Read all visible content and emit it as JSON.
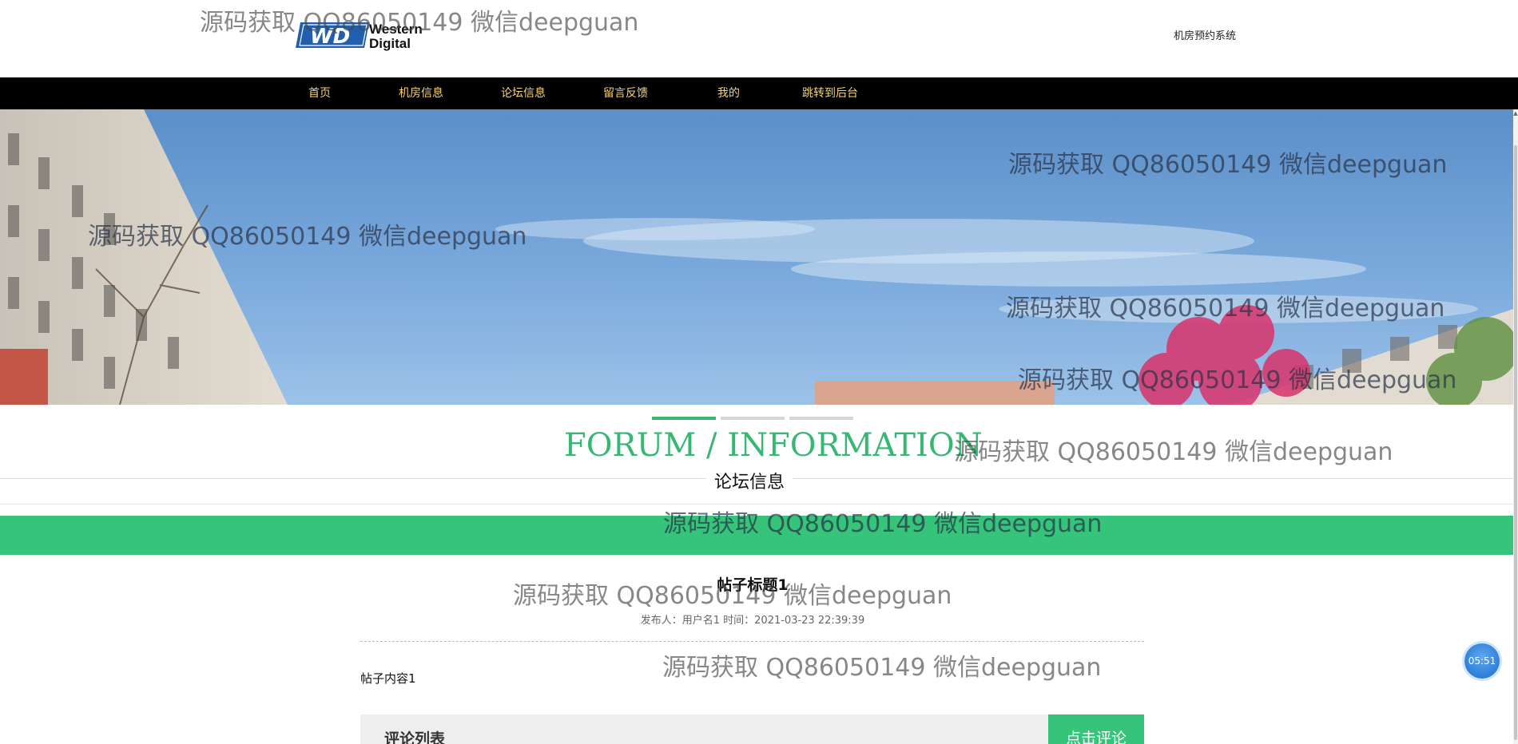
{
  "header": {
    "logo_line1": "Western",
    "logo_line2": "Digital",
    "logo_badge": "WD",
    "site_title": "机房预约系统"
  },
  "nav": {
    "items": [
      {
        "label": "首页"
      },
      {
        "label": "机房信息"
      },
      {
        "label": "论坛信息"
      },
      {
        "label": "留言反馈"
      },
      {
        "label": "我的"
      },
      {
        "label": "跳转到后台"
      }
    ]
  },
  "carousel": {
    "slide_count": 3,
    "active_index": 0
  },
  "section": {
    "title_en": "FORUM / INFORMATION",
    "title_cn": "论坛信息"
  },
  "post": {
    "title": "帖子标题1",
    "meta": "发布人：用户名1 时间：2021-03-23 22:39:39",
    "content": "帖子内容1"
  },
  "comments": {
    "title": "评论列表",
    "button_label": "点击评论"
  },
  "timer": {
    "label": "05:51"
  },
  "watermark": {
    "text": "源码获取 QQ86050149 微信deepguan"
  },
  "colors": {
    "accent": "#36c37a",
    "nav_bg": "#000000",
    "nav_text": "#f5d27a",
    "logo_blue": "#1f5fae"
  }
}
